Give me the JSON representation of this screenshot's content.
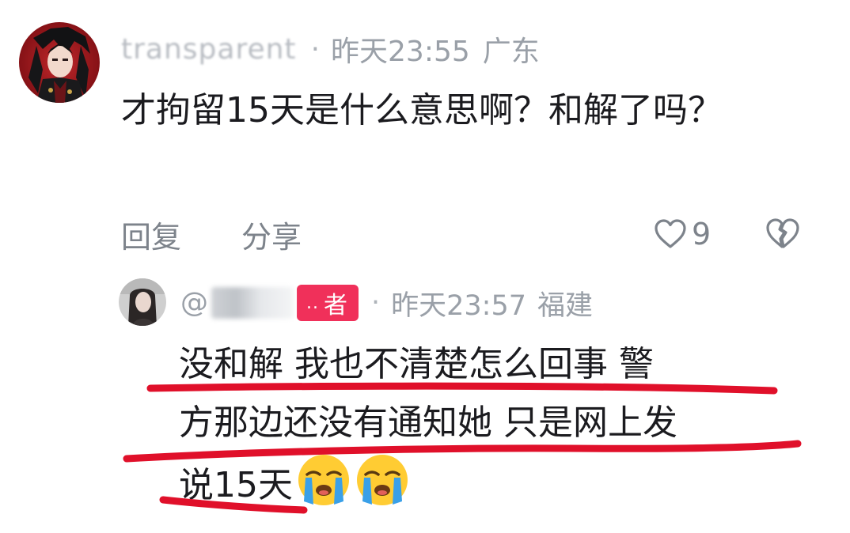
{
  "main_comment": {
    "username": "transparent",
    "separator": "·",
    "time": "昨天23:55",
    "region": "广东",
    "text": "才拘留15天是什么意思啊？和解了吗？",
    "actions": {
      "reply_label": "回复",
      "share_label": "分享",
      "like_count": "9"
    }
  },
  "reply": {
    "at_prefix": "@",
    "author_badge": "者",
    "separator": "·",
    "time": "昨天23:57",
    "region": "福建",
    "lines": [
      "没和解  我也不清楚怎么回事  警",
      "方那边还没有通知她  只是网上发",
      "说15天"
    ],
    "emojis": [
      "loudly-crying-face",
      "loudly-crying-face"
    ]
  },
  "colors": {
    "meta_gray": "#9aa0a8",
    "text_dark": "#1b1b1f",
    "author_badge_bg": "#f0305a",
    "annotation_red": "#e0102a"
  }
}
